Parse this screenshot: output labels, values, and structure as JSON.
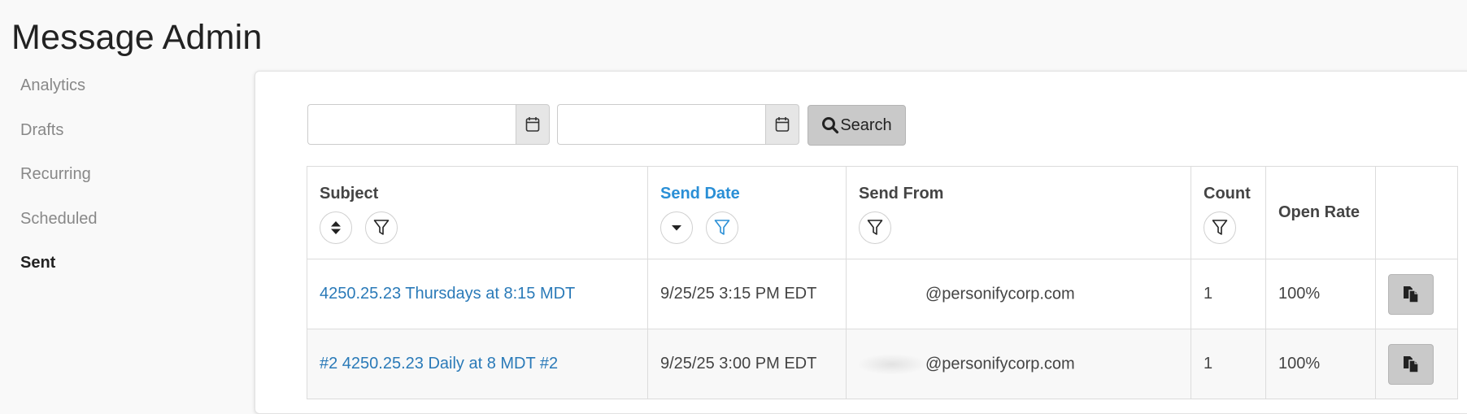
{
  "page": {
    "title": "Message Admin"
  },
  "sidebar": {
    "items": [
      {
        "label": "Analytics",
        "active": false
      },
      {
        "label": "Drafts",
        "active": false
      },
      {
        "label": "Recurring",
        "active": false
      },
      {
        "label": "Scheduled",
        "active": false
      },
      {
        "label": "Sent",
        "active": true
      }
    ]
  },
  "filters": {
    "start_date": {
      "value": "",
      "placeholder": ""
    },
    "end_date": {
      "value": "",
      "placeholder": ""
    },
    "calendar_icon": "calendar-icon",
    "search_label": "Search",
    "search_icon": "search-icon"
  },
  "table": {
    "columns": [
      {
        "label": "Subject",
        "sortable": true,
        "filterable": true,
        "sort_state": "none"
      },
      {
        "label": "Send Date",
        "sortable": true,
        "filterable": true,
        "sort_state": "descending",
        "active": true
      },
      {
        "label": "Send From",
        "sortable": false,
        "filterable": true
      },
      {
        "label": "Count",
        "sortable": false,
        "filterable": true
      },
      {
        "label": "Open Rate",
        "sortable": false,
        "filterable": false
      },
      {
        "label": "",
        "sortable": false,
        "filterable": false
      }
    ],
    "rows": [
      {
        "subject": "4250.25.23 Thursdays at 8:15 MDT",
        "send_date": "9/25/25 3:15 PM EDT",
        "send_from": "@personifycorp.com",
        "count": "1",
        "open_rate": "100%",
        "action_icon": "copy-icon"
      },
      {
        "subject": "#2 4250.25.23 Daily at 8 MDT #2",
        "send_date": "9/25/25 3:00 PM EDT",
        "send_from": "@personifycorp.com",
        "count": "1",
        "open_rate": "100%",
        "action_icon": "copy-icon"
      }
    ]
  },
  "colors": {
    "accent": "#2a8fd6",
    "link": "#2a7ab8",
    "button_gray": "#c9c9c9",
    "sidebar_text": "#888888"
  }
}
